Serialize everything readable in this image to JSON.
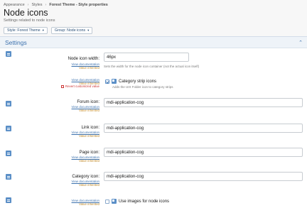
{
  "breadcrumb": [
    "Appearance",
    "Styles",
    "Forest Theme - Style properties"
  ],
  "page": {
    "title": "Node icons",
    "description": "Settings related to node icons"
  },
  "filters": {
    "style": "Style: Forest Theme",
    "group": "Group: Node icons"
  },
  "panel": {
    "title": "Settings"
  },
  "common": {
    "view_doc": "View documentation",
    "value_inherited": "Value inherited",
    "revert": "Revert customized value"
  },
  "fields": {
    "width": {
      "label": "Node icon width:",
      "value": "46px",
      "hint": "Sets the width for the node icon container (not the actual icon itself)"
    },
    "strip": {
      "label": "Category strip icons",
      "hint": "Adds the UIX Folder icon to category strips",
      "checked": true
    },
    "forum": {
      "label": "Forum icon:",
      "value": "mdi-application-cog"
    },
    "link": {
      "label": "Link icon:",
      "value": "mdi-application-cog"
    },
    "page": {
      "label": "Page icon:",
      "value": "mdi-application-cog"
    },
    "category": {
      "label": "Category icon:",
      "value": "mdi-application-cog"
    },
    "images": {
      "label": "Use images for node icons",
      "checked": false
    }
  }
}
